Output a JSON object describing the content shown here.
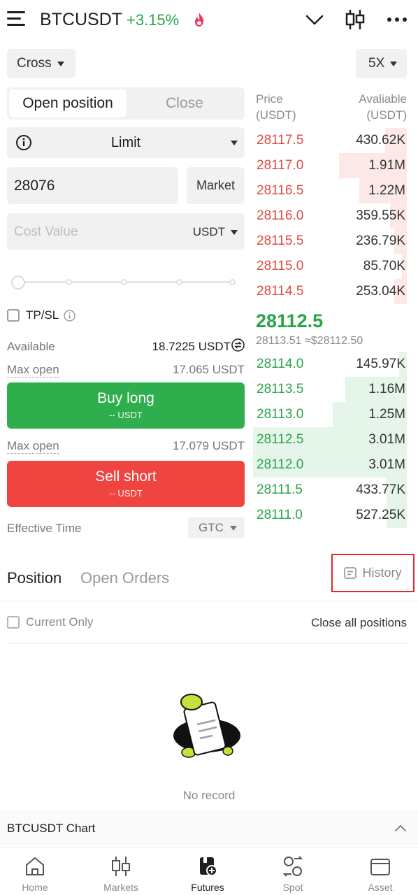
{
  "header": {
    "pair": "BTCUSDT",
    "change": "+3.15%"
  },
  "margin_mode": "Cross",
  "leverage": "5X",
  "order_tabs": [
    "Open position",
    "Close"
  ],
  "order_type": "Limit",
  "price_input": {
    "value": "28076"
  },
  "market_label": "Market",
  "cost_input": {
    "placeholder": "Cost Value",
    "unit": "USDT"
  },
  "tpsl_label": "TP/SL",
  "available": {
    "label": "Available",
    "value": "18.7225 USDT"
  },
  "buy": {
    "max_label": "Max open",
    "max_value": "17.065 USDT",
    "button_label": "Buy long",
    "button_sub": "-- USDT"
  },
  "sell": {
    "max_label": "Max open",
    "max_value": "17.079 USDT",
    "button_label": "Sell short",
    "button_sub": "-- USDT"
  },
  "effective_time": {
    "label": "Effective Time",
    "value": "GTC"
  },
  "orderbook": {
    "price_header": [
      "Price",
      "(USDT)"
    ],
    "amount_header": [
      "Avaliable",
      "(USDT)"
    ],
    "asks": [
      {
        "price": "28117.5",
        "amount": "430.62K",
        "depth": 0.14
      },
      {
        "price": "28117.0",
        "amount": "1.91M",
        "depth": 0.44
      },
      {
        "price": "28116.5",
        "amount": "1.22M",
        "depth": 0.31
      },
      {
        "price": "28116.0",
        "amount": "359.55K",
        "depth": 0.11
      },
      {
        "price": "28115.5",
        "amount": "236.79K",
        "depth": 0.08
      },
      {
        "price": "28115.0",
        "amount": "85.70K",
        "depth": 0.03
      },
      {
        "price": "28114.5",
        "amount": "253.04K",
        "depth": 0.08
      }
    ],
    "mid_price": "28112.5",
    "mid_sub": "28113.51 ≈$28112.50",
    "bids": [
      {
        "price": "28114.0",
        "amount": "145.97K",
        "depth": 0.05
      },
      {
        "price": "28113.5",
        "amount": "1.16M",
        "depth": 0.4
      },
      {
        "price": "28113.0",
        "amount": "1.25M",
        "depth": 0.48
      },
      {
        "price": "28112.5",
        "amount": "3.01M",
        "depth": 1.0
      },
      {
        "price": "28112.0",
        "amount": "3.01M",
        "depth": 1.0
      },
      {
        "price": "28111.5",
        "amount": "433.77K",
        "depth": 0.13
      },
      {
        "price": "28111.0",
        "amount": "527.25K",
        "depth": 0.13
      }
    ]
  },
  "positions": {
    "tabs": [
      "Position",
      "Open Orders"
    ],
    "history_label": "History",
    "current_only": "Current Only",
    "close_all": "Close all positions",
    "empty_text": "No record"
  },
  "chart_bar": {
    "label": "BTCUSDT Chart"
  },
  "nav": [
    {
      "label": "Home",
      "icon": "home-icon"
    },
    {
      "label": "Markets",
      "icon": "markets-icon"
    },
    {
      "label": "Futures",
      "icon": "futures-icon",
      "active": true
    },
    {
      "label": "Spot",
      "icon": "spot-icon"
    },
    {
      "label": "Asset",
      "icon": "asset-icon"
    }
  ],
  "colors": {
    "up": "#2aa54a",
    "down": "#e04b43",
    "buy": "#2fae4d",
    "sell": "#ef4440",
    "highlight": "#e6262c"
  }
}
